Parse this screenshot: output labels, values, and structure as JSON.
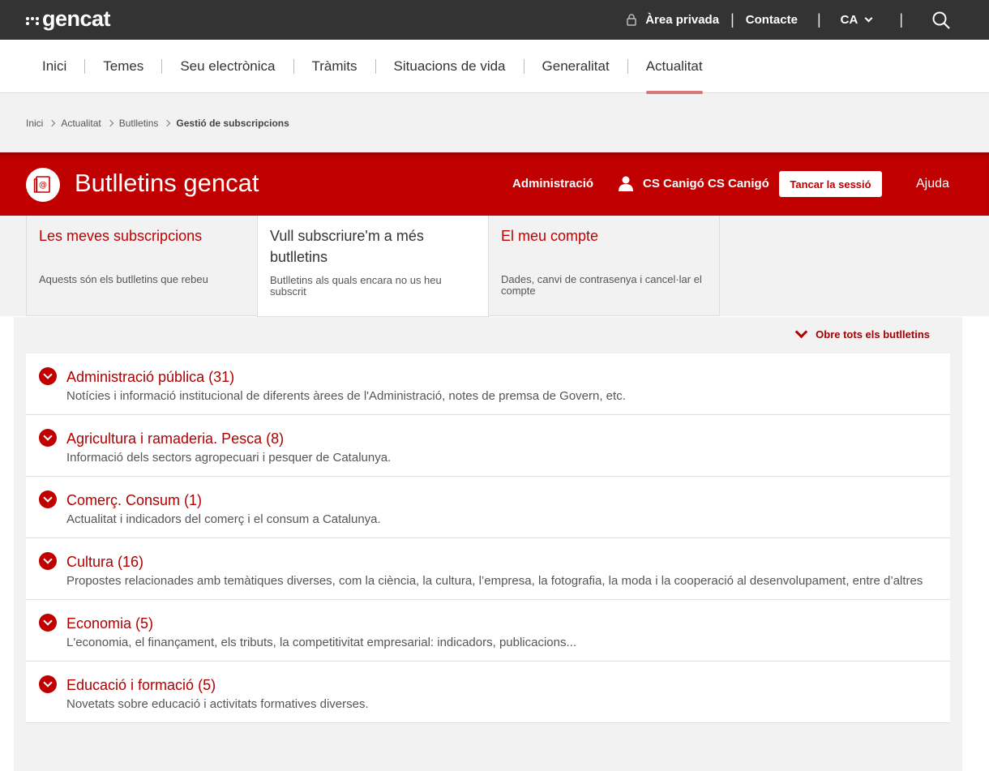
{
  "topbar": {
    "logo": "gencat",
    "private_area": "Àrea privada",
    "contact": "Contacte",
    "language": "CA"
  },
  "nav": {
    "items": [
      "Inici",
      "Temes",
      "Seu electrònica",
      "Tràmits",
      "Situacions de vida",
      "Generalitat",
      "Actualitat"
    ],
    "active": "Actualitat"
  },
  "breadcrumb": [
    "Inici",
    "Actualitat",
    "Butlletins",
    "Gestió de subscripcions"
  ],
  "header": {
    "title": "Butlletins gencat",
    "admin": "Administració",
    "user": "CS Canigó CS Canigó",
    "logout": "Tancar la sessió",
    "help": "Ajuda",
    "color": "#c00000"
  },
  "tabs": [
    {
      "title": "Les meves subscripcions",
      "desc": "Aquests són els butlletins que rebeu"
    },
    {
      "title": "Vull subscriure'm a més butlletins",
      "desc": "Butlletins als quals encara no us heu subscrit"
    },
    {
      "title": "El meu compte",
      "desc": "Dades, canvi de contrasenya i cancel·lar el compte"
    }
  ],
  "expand_all": "Obre tots els butlletins",
  "categories": [
    {
      "title": "Administració pública (31)",
      "desc": "Notícies i informació institucional de diferents àrees de l'Administració, notes de premsa de Govern, etc."
    },
    {
      "title": "Agricultura i ramaderia. Pesca (8)",
      "desc": "Informació dels sectors agropecuari i pesquer de Catalunya."
    },
    {
      "title": "Comerç. Consum (1)",
      "desc": "Actualitat i indicadors del comerç i el consum a Catalunya."
    },
    {
      "title": "Cultura (16)",
      "desc": "Propostes relacionades amb temàtiques diverses, com la ciència, la cultura, l’empresa, la fotografia, la moda i la cooperació al desenvolupament, entre d’altres"
    },
    {
      "title": "Economia (5)",
      "desc": "L'economia, el finançament, els tributs, la competitivitat empresarial: indicadors, publicacions..."
    },
    {
      "title": "Educació i formació (5)",
      "desc": "Novetats sobre educació i activitats formatives diverses."
    }
  ]
}
